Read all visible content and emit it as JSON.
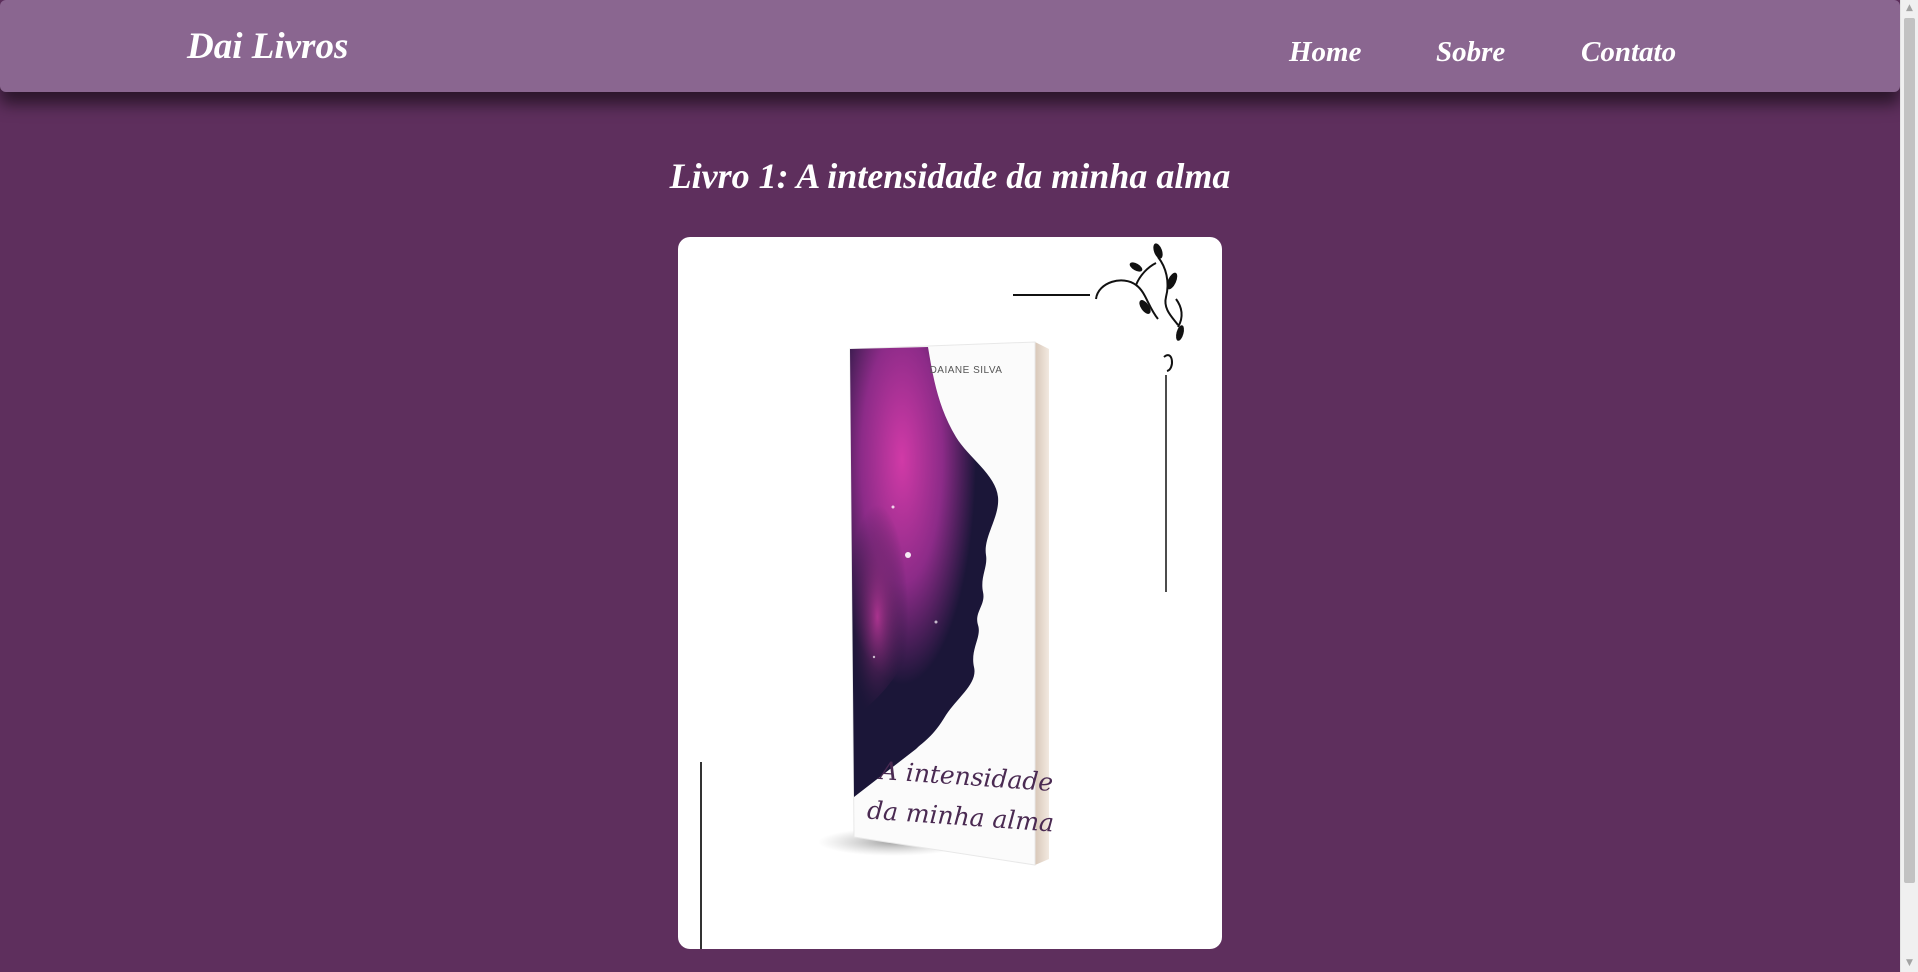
{
  "header": {
    "brand": "Dai Livros",
    "nav": [
      {
        "label": "Home"
      },
      {
        "label": "Sobre"
      },
      {
        "label": "Contato"
      }
    ]
  },
  "main": {
    "title": "Livro 1: A intensidade da minha alma",
    "cover": {
      "alt": "Capa do livro A intensidade da minha alma",
      "author": "DAIANE SILVA",
      "title_line1": "A intensidade",
      "title_line2": "da minha alma"
    }
  },
  "scrollbar": {
    "up_icon": "▲",
    "down_icon": "▼"
  },
  "colors": {
    "page_background": "#5e2f5d",
    "navbar_background": "#8a6690",
    "text": "#ffffff",
    "card_background": "#ffffff"
  }
}
